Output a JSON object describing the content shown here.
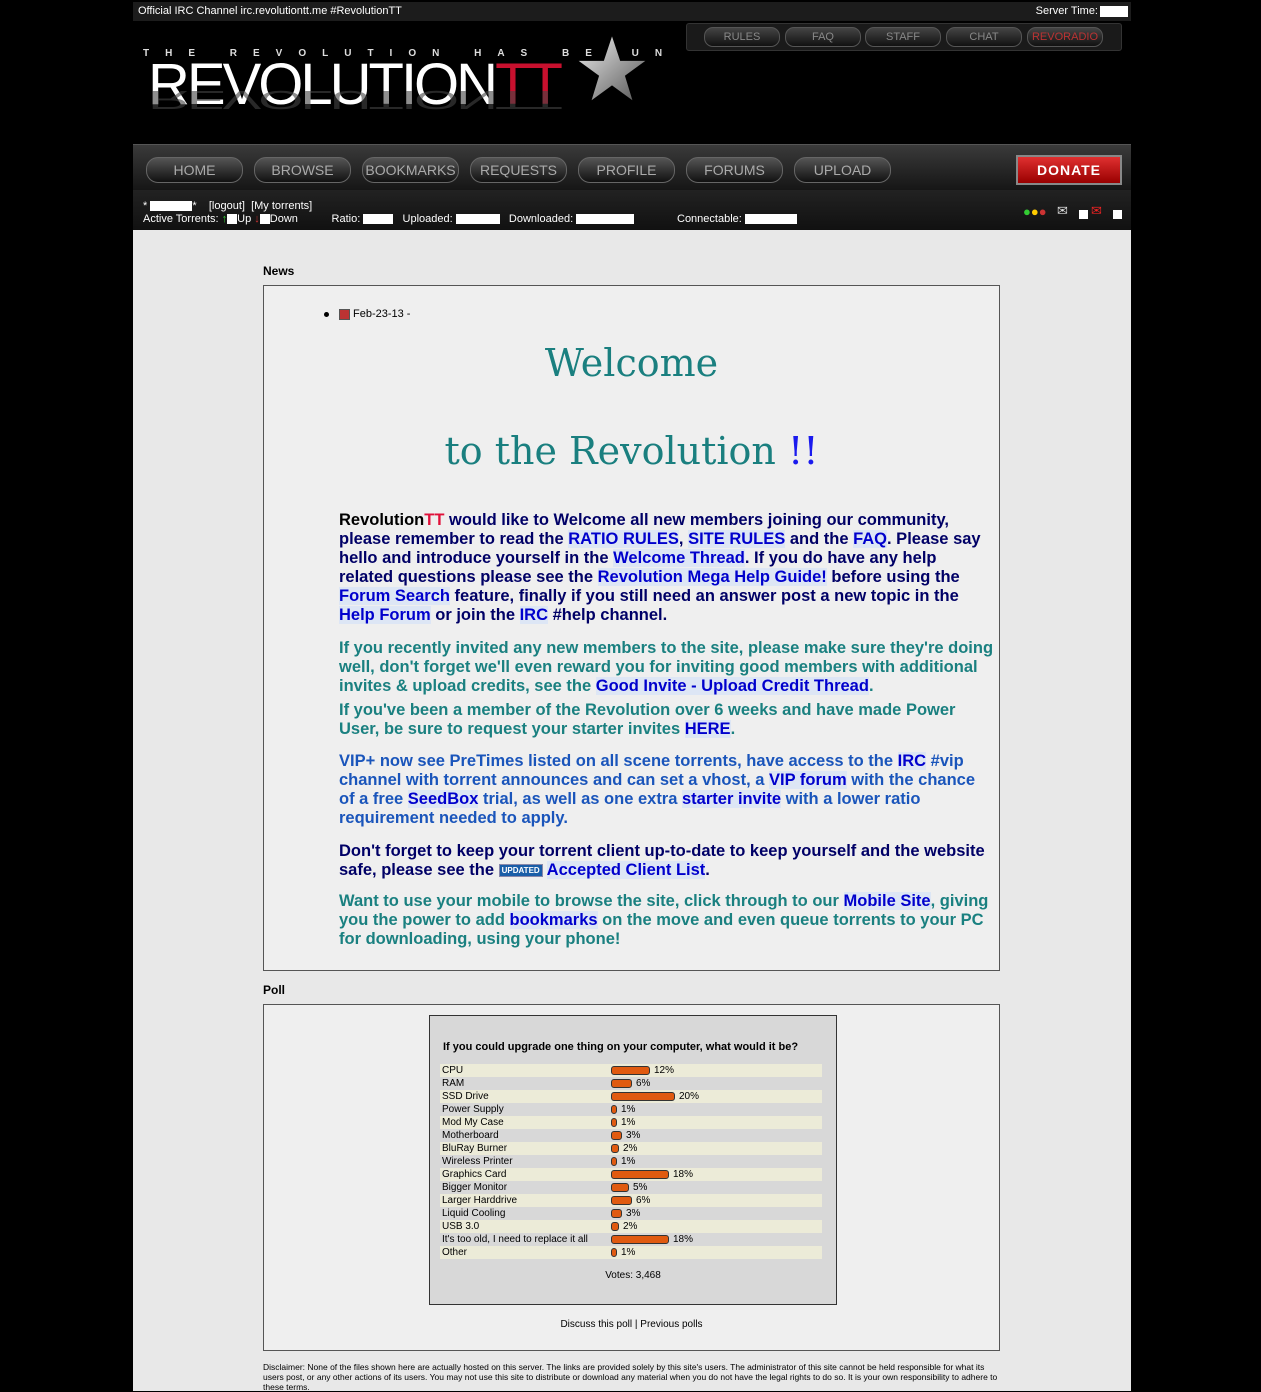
{
  "topbar": {
    "irc": "Official IRC Channel irc.revolutiontt.me #RevolutionTT",
    "server_time_label": "Server Time:"
  },
  "logo": {
    "tagline": "THE REVOLUTION HAS BEGUN",
    "main": "REVOLUTION",
    "tt": "TT"
  },
  "topnav": [
    "RULES",
    "FAQ",
    "STAFF",
    "CHAT",
    "REVORADIO"
  ],
  "mainnav": [
    "HOME",
    "BROWSE",
    "BOOKMARKS",
    "REQUESTS",
    "PROFILE",
    "FORUMS",
    "UPLOAD"
  ],
  "donate": "DONATE",
  "userbar": {
    "logout": "[logout]",
    "my_torrents": "[My torrents]",
    "active": "Active Torrents:",
    "up": "Up",
    "down": "Down",
    "ratio": "Ratio:",
    "uploaded": "Uploaded:",
    "downloaded": "Downloaded:",
    "connectable": "Connectable:"
  },
  "news": {
    "heading": "News",
    "date": "Feb-23-13 -",
    "welcome1": "Welcome",
    "welcome2": "to the Revolution",
    "welcome2_mark": "!!",
    "p1": {
      "brand": "Revolution",
      "brand_tt": "TT",
      "t1": " would like to Welcome all new members joining our community, please remember to read the ",
      "l1": "RATIO RULES",
      "t2": ", ",
      "l2": "SITE RULES",
      "t3": " and the ",
      "l3": "FAQ",
      "t4": ". Please say hello and introduce yourself in the ",
      "l4": "Welcome Thread",
      "t5": ". If you do have any help related questions please see the ",
      "l5": "Revolution Mega Help Guide!",
      "t6": " before using the ",
      "l6": "Forum Search",
      "t7": " feature, finally if you still need an answer post a new topic in the ",
      "l7": "Help Forum",
      "t8": " or join the ",
      "l8": "IRC",
      "t9": " #help channel."
    },
    "p2": {
      "t1": "If you recently invited any new members to the site, please make sure they're doing well, don't forget we'll even reward you for inviting good members with additional invites & upload credits, see the ",
      "l1": "Good Invite - Upload Credit Thread",
      "t2": "."
    },
    "p3": {
      "t1": "If you've been a member of the Revolution over 6 weeks and have made Power User, be sure to request your starter invites ",
      "l1": "HERE",
      "t2": "."
    },
    "p4": {
      "t1": "VIP+ now see PreTimes listed on all scene torrents, have access to the ",
      "l1": "IRC",
      "t2": " #vip channel with torrent announces and can set a vhost, a ",
      "l2": "VIP forum",
      "t3": " with the chance of a free ",
      "l3": "SeedBox",
      "t4": " trial, as well as one extra ",
      "l4": "starter invite",
      "t5": " with a lower ratio requirement needed to apply."
    },
    "p5": {
      "t1": "Don't forget to keep your torrent client up-to-date to keep yourself and the website safe, please see the ",
      "badge": "UPDATED",
      "l1": "Accepted Client List",
      "t2": "."
    },
    "p6": {
      "t1": "Want to use your mobile to browse the site, click through to our ",
      "l1": "Mobile Site",
      "t2": ", giving you the power to add ",
      "l2": "bookmarks",
      "t3": " on the move and even queue torrents to your PC for downloading, using your phone!"
    }
  },
  "poll": {
    "heading": "Poll",
    "question": "If you could upgrade one thing on your computer, what would it be?",
    "options": [
      {
        "label": "CPU",
        "pct": 12
      },
      {
        "label": "RAM",
        "pct": 6
      },
      {
        "label": "SSD Drive",
        "pct": 20
      },
      {
        "label": "Power Supply",
        "pct": 1
      },
      {
        "label": "Mod My Case",
        "pct": 1
      },
      {
        "label": "Motherboard",
        "pct": 3
      },
      {
        "label": "BluRay Burner",
        "pct": 2
      },
      {
        "label": "Wireless Printer",
        "pct": 1
      },
      {
        "label": "Graphics Card",
        "pct": 18
      },
      {
        "label": "Bigger Monitor",
        "pct": 5
      },
      {
        "label": "Larger Harddrive",
        "pct": 6
      },
      {
        "label": "Liquid Cooling",
        "pct": 3
      },
      {
        "label": "USB 3.0",
        "pct": 2
      },
      {
        "label": "It's too old, I need to replace it all",
        "pct": 18
      },
      {
        "label": "Other",
        "pct": 1
      }
    ],
    "votes": "Votes: 3,468",
    "discuss": "Discuss this poll",
    "sep": " | ",
    "previous": "Previous polls"
  },
  "disclaimer": "Disclaimer: None of the files shown here are actually hosted on this server. The links are provided solely by this site's users. The administrator of this site cannot be held responsible for what its users post, or any other actions of its users. You may not use this site to distribute or download any material when you do not have the legal rights to do so. It is your own responsibility to adhere to these terms."
}
